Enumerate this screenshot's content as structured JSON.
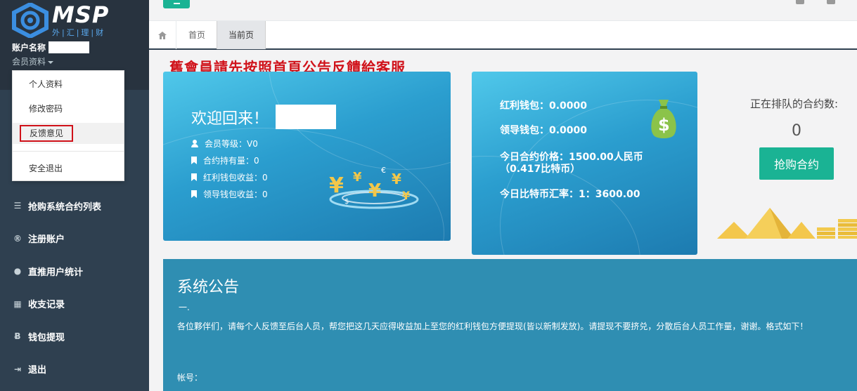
{
  "logo": {
    "title": "MSP",
    "subtitle": "外|汇|理|财"
  },
  "account": {
    "name_label": "账户名称",
    "menu_label": "会员资料"
  },
  "member_menu": {
    "profile": "个人资料",
    "change_password": "修改密码",
    "feedback": "反馈意见",
    "logout": "安全退出"
  },
  "nav": [
    {
      "label": "抢购系统合约列表",
      "icon": "list-icon"
    },
    {
      "label": "注册账户",
      "icon": "registered-icon"
    },
    {
      "label": "直推用户统计",
      "icon": "user-icon"
    },
    {
      "label": "收支记录",
      "icon": "grid-icon"
    },
    {
      "label": "钱包提现",
      "icon": "bitcoin-icon"
    },
    {
      "label": "退出",
      "icon": "sign-out-icon"
    }
  ],
  "tabs": {
    "home": "首页",
    "current": "当前页"
  },
  "notice_banner": "舊會員請先按照首頁公告反饋給客服",
  "welcome": {
    "title": "欢迎回来！",
    "member_level": "会员等级：V0",
    "contracts_held": "合约持有量：0",
    "bonus_wallet_income": "红利钱包收益：0",
    "leader_wallet_income": "领导钱包收益：0"
  },
  "wallet": {
    "bonus_wallet": "红利钱包：0.0000",
    "leader_wallet": "领导钱包：0.0000",
    "today_price": "今日合约价格：1500.00人民币",
    "today_price_btc": "（0.417比特币）",
    "exchange_rate": "今日比特币汇率：1：3600.00"
  },
  "queue": {
    "label": "正在排队的合约数:",
    "count": "0",
    "buy_button": "抢购合约"
  },
  "announcement": {
    "title": "系统公告",
    "sub": "一.",
    "body": "各位夥伴们，请每个人反馈至后台人员，帮您把这几天应得收益加上至您的红利钱包方便提现(皆以新制发放)。请提现不要挤兑，分散后台人员工作量，谢谢。格式如下！",
    "account_label": "帐号："
  },
  "colors": {
    "sidebar": "#2f4050",
    "accent": "#1ab394",
    "notice_red": "#d0121a",
    "announce_bg": "#2f8eb2"
  }
}
